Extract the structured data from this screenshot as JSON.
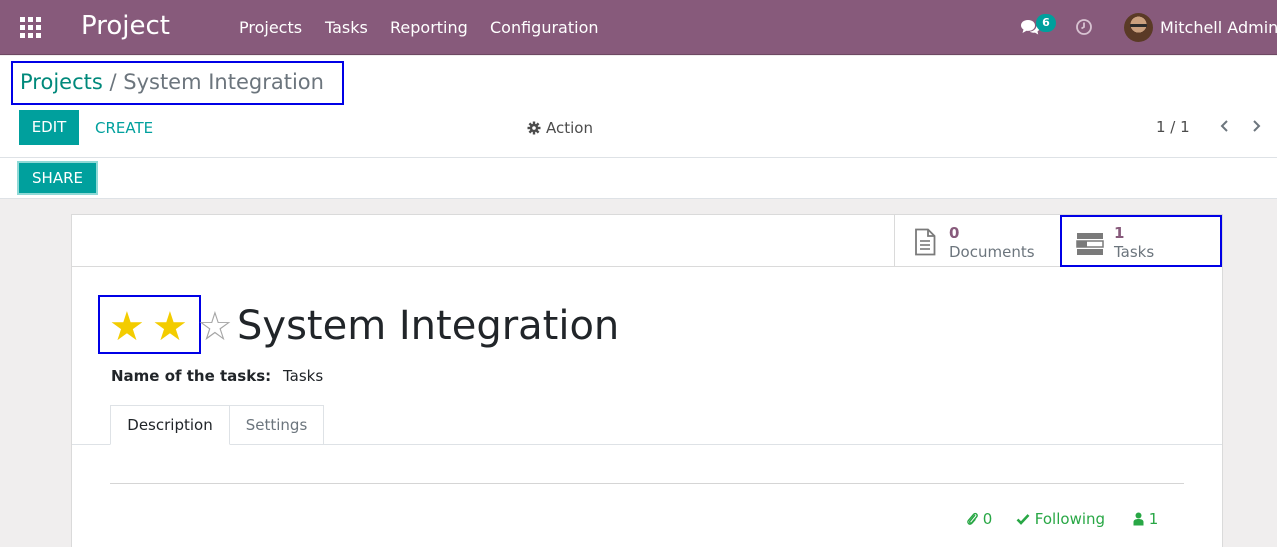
{
  "navbar": {
    "app_title": "Project",
    "menu": [
      "Projects",
      "Tasks",
      "Reporting",
      "Configuration"
    ],
    "messages_count": "6",
    "user_name": "Mitchell Admin"
  },
  "breadcrumb": {
    "parent": "Projects",
    "separator": "/",
    "current": "System Integration"
  },
  "toolbar": {
    "edit_label": "EDIT",
    "create_label": "CREATE",
    "action_label": "Action",
    "pager_value": "1 / 1"
  },
  "statusbar": {
    "share_label": "SHARE"
  },
  "smart_buttons": {
    "documents": {
      "value": "0",
      "label": "Documents"
    },
    "tasks": {
      "value": "1",
      "label": "Tasks"
    }
  },
  "record": {
    "priority_stars_filled": 2,
    "priority_stars_total": 3,
    "title": "System Integration",
    "tasks_name_label": "Name of the tasks:",
    "tasks_name_value": "Tasks"
  },
  "tabs": [
    "Description",
    "Settings"
  ],
  "chatter": {
    "attachments_count": "0",
    "follow_label": "Following",
    "followers_count": "1"
  },
  "colors": {
    "navbar": "#875a7b",
    "primary": "#00a09d",
    "star_filled": "#f3cc00",
    "highlight_border": "#0000e6",
    "following": "#28a745"
  }
}
